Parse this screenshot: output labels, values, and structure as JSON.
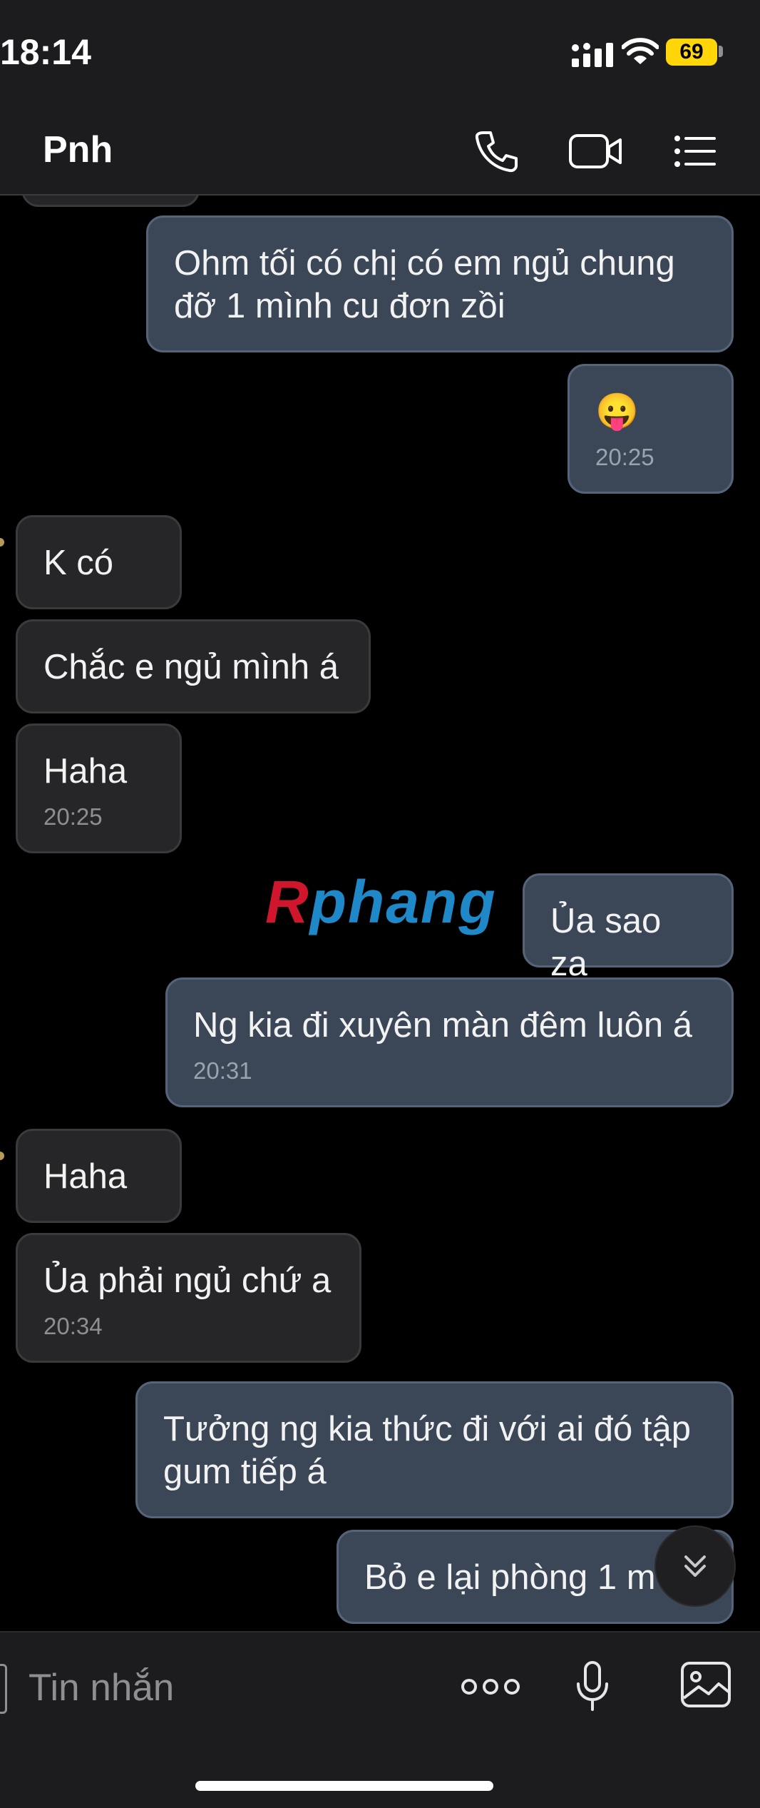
{
  "status_bar": {
    "time": "18:14",
    "battery": "69"
  },
  "header": {
    "contact_name": "Pnh"
  },
  "watermark": {
    "part1": "R",
    "part2": "phang"
  },
  "messages": [
    {
      "dir": "out",
      "text": "Ohm tối có chị có em ngủ chung\nđỡ 1 mình cu đơn zồi",
      "time": ""
    },
    {
      "dir": "out",
      "text": "😛",
      "time": "20:25"
    },
    {
      "dir": "in",
      "text": "K có",
      "time": ""
    },
    {
      "dir": "in",
      "text": "Chắc e ngủ mình á",
      "time": ""
    },
    {
      "dir": "in",
      "text": "Haha",
      "time": "20:25"
    },
    {
      "dir": "out",
      "text": "Ủa sao zạ",
      "time": ""
    },
    {
      "dir": "out",
      "text": "Ng kia đi xuyên màn đêm luôn á",
      "time": "20:31"
    },
    {
      "dir": "in",
      "text": "Haha",
      "time": ""
    },
    {
      "dir": "in",
      "text": "Ủa phải ngủ chứ a",
      "time": "20:34"
    },
    {
      "dir": "out",
      "text": "Tưởng ng kia thức đi với ai đó tập\ngum tiếp á",
      "time": ""
    },
    {
      "dir": "out",
      "text": "Bỏ e lại phòng 1 m",
      "time": ""
    }
  ],
  "composer": {
    "placeholder": "Tin nhắn"
  },
  "icons": {
    "call": "phone-icon",
    "video": "video-camera-icon",
    "menu": "list-menu-icon",
    "more": "more-dots-icon",
    "mic": "microphone-icon",
    "gallery": "image-icon",
    "scroll": "chevron-double-down-icon"
  },
  "colors": {
    "outgoing_bubble": "#3b4657",
    "incoming_bubble": "#262628",
    "battery": "#ffd60a"
  }
}
